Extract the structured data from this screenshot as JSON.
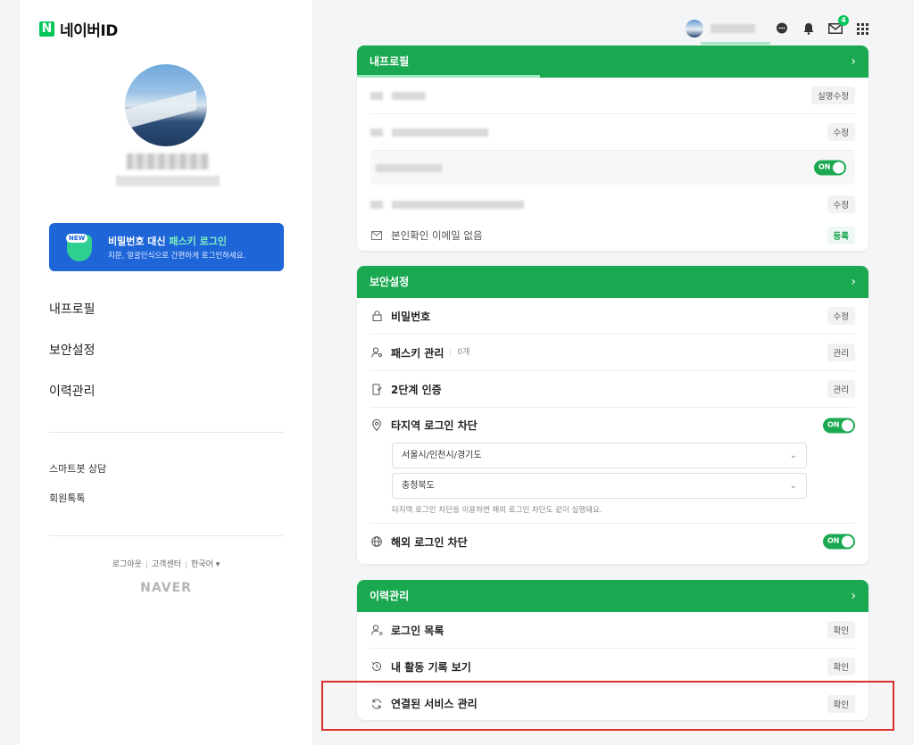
{
  "app": {
    "logo_letter": "N",
    "logo_text": "네이버ID"
  },
  "banner": {
    "new_label": "NEW",
    "title_prefix": "비밀번호 대신 ",
    "title_highlight": "패스키 로그인",
    "subtitle": "지문, 얼굴인식으로 간편하게 로그인하세요."
  },
  "nav": {
    "items": [
      "내프로필",
      "보안설정",
      "이력관리"
    ]
  },
  "subnav": {
    "items": [
      "스마트봇 상담",
      "회원톡톡"
    ]
  },
  "footer": {
    "links": [
      "로그아웃",
      "고객센터",
      "한국어 ▾"
    ],
    "brand": "NAVER"
  },
  "topbar": {
    "mail_badge": "4"
  },
  "profile_card": {
    "title": "내프로필",
    "row1_button": "실명수정",
    "row2_button": "수정",
    "row3_toggle": "ON",
    "row4_button": "수정",
    "row5_label": "본인확인 이메일 없음",
    "row5_button": "등록"
  },
  "security_card": {
    "title": "보안설정",
    "rows": [
      {
        "label": "비밀번호",
        "button": "수정"
      },
      {
        "label": "패스키 관리",
        "sub": "0개",
        "button": "관리"
      },
      {
        "label": "2단계 인증",
        "button": "관리"
      },
      {
        "label": "타지역 로그인 차단",
        "toggle": "ON"
      }
    ],
    "regions": [
      "서울시/인천시/경기도",
      "충청북도"
    ],
    "region_hint": "타지역 로그인 차단을 이용하면 해외 로그인 차단도 같이 실행돼요.",
    "overseas": {
      "label": "해외 로그인 차단",
      "toggle": "ON"
    }
  },
  "history_card": {
    "title": "이력관리",
    "rows": [
      {
        "label": "로그인 목록",
        "button": "확인"
      },
      {
        "label": "내 활동 기록 보기",
        "button": "확인"
      },
      {
        "label": "연결된 서비스 관리",
        "button": "확인"
      }
    ]
  },
  "colors": {
    "brand_green": "#1aa851",
    "banner_blue": "#1e66d8",
    "highlight_red": "#d9302c"
  }
}
